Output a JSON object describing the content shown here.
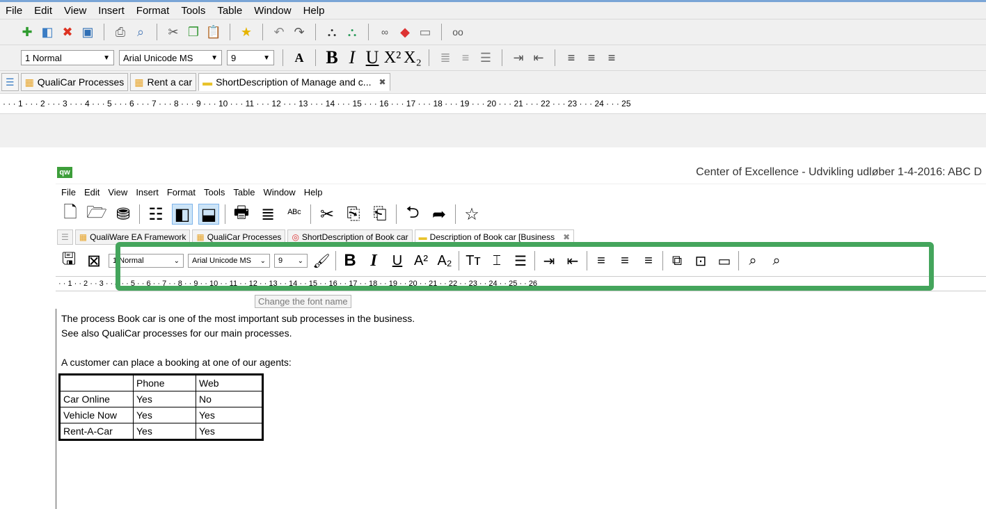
{
  "old_ui": {
    "menu": [
      "File",
      "Edit",
      "View",
      "Insert",
      "Format",
      "Tools",
      "Table",
      "Window",
      "Help"
    ],
    "style_combo": "1 Normal",
    "font_combo": "Arial Unicode MS",
    "size_combo": "9",
    "tabs": [
      {
        "label": ""
      },
      {
        "label": "QualiCar Processes"
      },
      {
        "label": "Rent a car"
      },
      {
        "label": "ShortDescription of Manage and c..."
      }
    ],
    "ruler": "·  ·  ·  1  ·  ·  ·  2  ·  ·  ·  3  ·  ·  ·  4  ·  ·  ·  5  ·  ·  ·  6  ·  ·  ·  7  ·  ·  ·  8  ·  ·  ·  9  ·  ·  · 10  ·  ·  · 11  ·  ·  · 12  ·  ·  · 13  ·  ·  · 14  ·  ·  · 15  ·  ·  · 16  ·  ·  · 17  ·  ·  · 18  ·  ·  · 19  ·  ·  · 20  ·  ·  · 21  ·  ·  · 22  ·  ·  · 23  ·  ·  · 24  ·  ·  · 25"
  },
  "new_ui": {
    "logo": "qw",
    "title": "Center of Excellence - Udvikling udløber 1-4-2016: ABC D",
    "menu": [
      "File",
      "Edit",
      "View",
      "Insert",
      "Format",
      "Tools",
      "Table",
      "Window",
      "Help"
    ],
    "tabs": [
      {
        "label": ""
      },
      {
        "label": "QualiWare EA Framework"
      },
      {
        "label": "QualiCar Processes"
      },
      {
        "label": "ShortDescription of Book car"
      },
      {
        "label": "Description of Book car [Business"
      }
    ],
    "style_combo": "1 Normal",
    "font_combo": "Arial Unicode MS",
    "size_combo": "9",
    "ruler": "·  ·  1  ·  ·  2  ·  ·  3  ·  ·  4  ·  ·  5  ·  ·  6  ·  ·  7  ·  ·  8  ·  ·  9  ·  ·  10  ·  ·  11  ·  ·  12  ·  ·  13  ·  ·  14  ·  ·  15  ·  ·  16  ·  ·  17  ·  ·  18  ·  ·  19  ·  ·  20  ·  ·  21  ·  ·  22  ·  ·  23  ·  ·  24  ·  ·  25  ·  ·  26",
    "tooltip": "Change the font name"
  },
  "document": {
    "line1": "The process Book car is one of the most important sub processes in the business.",
    "line2": "See also QualiCar processes for our main processes.",
    "line3": "A customer can place a booking at one of our agents:",
    "table": {
      "headers": [
        "",
        "Phone",
        "Web"
      ],
      "rows": [
        [
          "Car Online",
          "Yes",
          "No"
        ],
        [
          "Vehicle Now",
          "Yes",
          "Yes"
        ],
        [
          "Rent-A-Car",
          "Yes",
          "Yes"
        ]
      ]
    }
  },
  "colors": {
    "highlight": "#44a55c",
    "logo": "#3d9e3a"
  }
}
